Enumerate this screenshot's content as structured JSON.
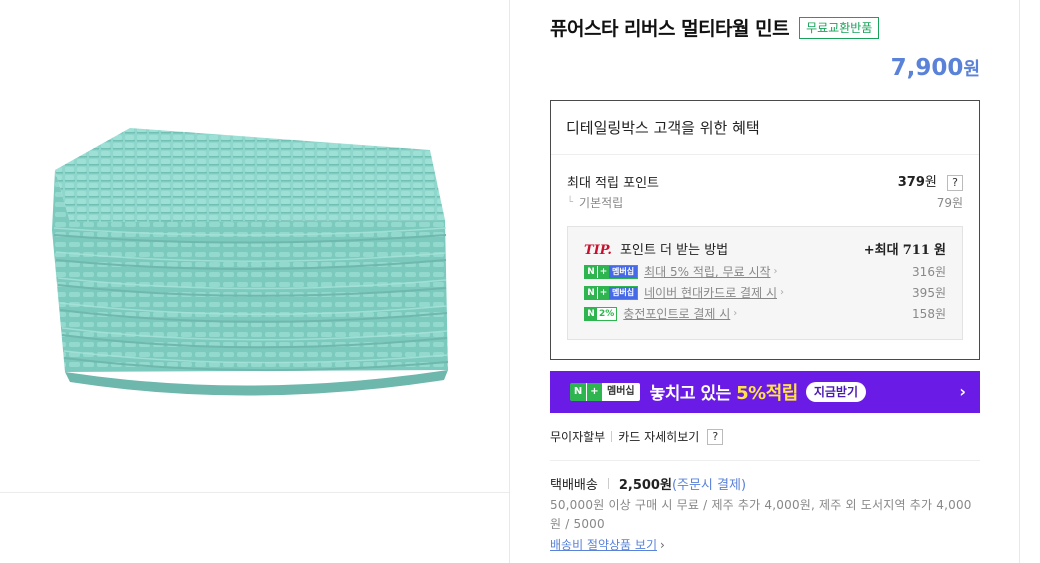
{
  "product": {
    "title": "퓨어스타 리버스 멀티타월 민트",
    "badge": "무료교환반품",
    "price_number": "7,900",
    "price_unit": "원",
    "image_color": "#8fd6cc"
  },
  "benefit": {
    "title": "디테일링박스 고객을 위한 혜택",
    "max_point_label": "최대 적립 포인트",
    "max_point_value": "379",
    "max_point_unit": "원",
    "help": "?",
    "base_label": "기본적립",
    "base_value": "79원",
    "tip": {
      "tip_word": "TIP.",
      "title": "포인트 더 받는 방법",
      "max_prefix": "+최대",
      "max_value": "711",
      "max_unit": "원",
      "items": [
        {
          "badge": "멤버십",
          "text": "최대 5% 적립, 무료 시작",
          "value": "316원"
        },
        {
          "badge": "멤버십",
          "text": "네이버 현대카드로 결제 시",
          "value": "395원"
        },
        {
          "badge": "2%",
          "text": "충전포인트로 결제 시",
          "value": "158원"
        }
      ]
    }
  },
  "promo": {
    "badge": "멤버십",
    "text_pre": "놓치고 있는",
    "text_highlight": "5%적립",
    "cta": "지금받기",
    "arrow": "›",
    "bg_color": "#6a1be6"
  },
  "installment": {
    "label1": "무이자할부",
    "label2": "카드 자세히보기",
    "help": "?"
  },
  "shipping": {
    "label": "택배배송",
    "fee": "2,500원",
    "note": "(주문시 결제)",
    "detail": "50,000원 이상 구매 시 무료 / 제주 추가 4,000원, 제주 외 도서지역 추가 4,000원 / 5000",
    "link": "배송비 절약상품 보기"
  }
}
